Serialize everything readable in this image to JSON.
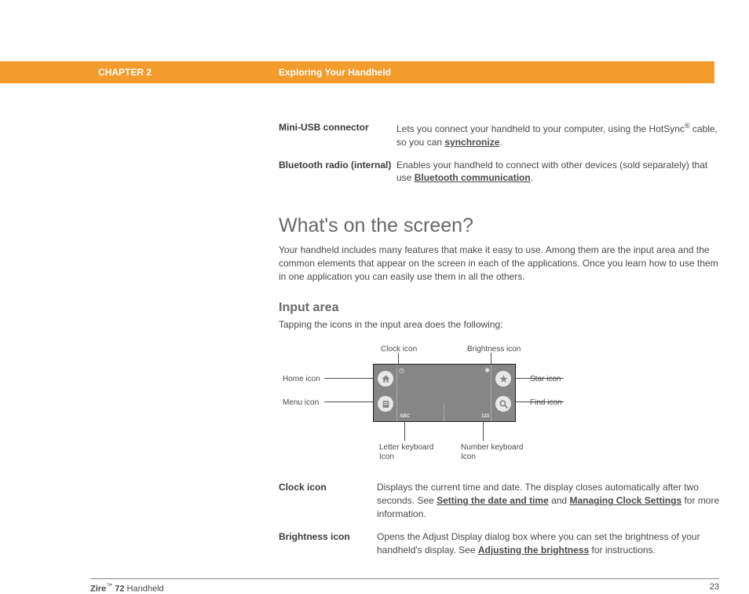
{
  "header": {
    "chapter": "CHAPTER 2",
    "title": "Exploring Your Handheld"
  },
  "features": {
    "usb": {
      "label": "Mini-USB connector",
      "desc1": "Lets you connect your handheld to your computer, using the HotSync",
      "desc2": " cable, so you can ",
      "link": "synchronize",
      "period": "."
    },
    "bt": {
      "label": "Bluetooth radio (internal)",
      "desc1": "Enables your handheld to connect with other devices (sold separately) that use ",
      "link": "Bluetooth communication",
      "period": "."
    }
  },
  "section": {
    "h1": "What's on the screen?",
    "p1": "Your handheld includes many features that make it easy to use. Among them are the input area and the common elements that appear on the screen in each of the applications. Once you learn how to use them in one application you can easily use them in all the others.",
    "h2": "Input area",
    "p2": "Tapping the icons in the input area does the following:"
  },
  "diagram": {
    "clock": "Clock icon",
    "brightness": "Brightness icon",
    "home": "Home icon",
    "star": "Star icon",
    "menu": "Menu icon",
    "find": "Find icon",
    "letterkb1": "Letter keyboard",
    "letterkb2": "Icon",
    "numkb1": "Number keyboard",
    "numkb2": "Icon",
    "abc": "ABC",
    "num": "123"
  },
  "icons": {
    "clock": {
      "label": "Clock icon",
      "d1": "Displays the current time and date. The display closes automatically after two seconds. See ",
      "link1": "Setting the date and time",
      "d2": " and ",
      "link2": "Managing Clock Settings",
      "d3": " for more information."
    },
    "bright": {
      "label": "Brightness icon",
      "d1": "Opens the Adjust Display dialog box where you can set the brightness of your handheld's display. See ",
      "link1": "Adjusting the brightness",
      "d2": " for instructions."
    }
  },
  "footer": {
    "product1": "Zire",
    "product2": " 72",
    "product3": " Handheld",
    "page": "23"
  }
}
